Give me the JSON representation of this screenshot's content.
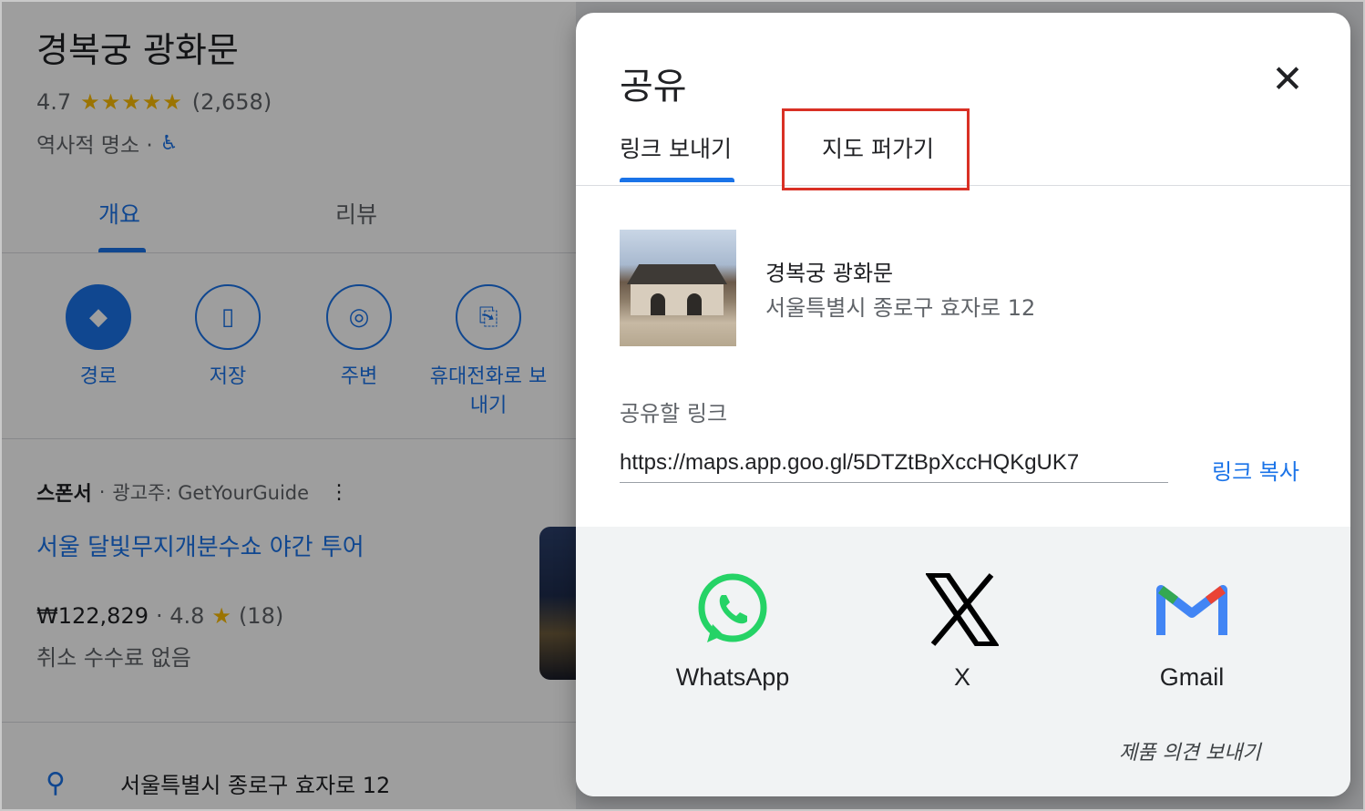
{
  "place": {
    "title": "경복궁 광화문",
    "rating": "4.7",
    "stars": "★★★★★",
    "review_count": "(2,658)",
    "category": "역사적 명소 ·",
    "tabs": [
      "개요",
      "리뷰"
    ],
    "actions": [
      {
        "label": "경로",
        "icon": "directions-icon"
      },
      {
        "label": "저장",
        "icon": "bookmark-icon"
      },
      {
        "label": "주변",
        "icon": "nearby-icon"
      },
      {
        "label": "휴대전화로 보\n내기",
        "icon": "send-to-phone-icon"
      }
    ],
    "sponsor": {
      "label": "스폰서",
      "advertiser": "광고주: GetYourGuide"
    },
    "ad_title": "서울 달빛무지개분수쇼 야간 투어",
    "ad_price": "₩122,829",
    "ad_rating": "· 4.8",
    "ad_star": "★",
    "ad_reviews": "(18)",
    "ad_note": "취소 수수료 없음",
    "address": "서울특별시 종로구 효자로 12"
  },
  "dialog": {
    "title": "공유",
    "close_glyph": "✕",
    "tabs": [
      "링크 보내기",
      "지도 퍼가기"
    ],
    "place_name": "경복궁 광화문",
    "place_address": "서울특별시 종로구 효자로 12",
    "link_label": "공유할 링크",
    "link_value": "https://maps.app.goo.gl/5DTZtBpXccHQKgUK7",
    "copy_label": "링크 복사",
    "share_targets": [
      {
        "label": "WhatsApp",
        "icon": "whatsapp-icon",
        "color": "#25d366"
      },
      {
        "label": "X",
        "icon": "x-icon",
        "color": "#000000"
      },
      {
        "label": "Gmail",
        "icon": "gmail-icon",
        "color": "#4285f4"
      }
    ],
    "feedback": "제품 의견 보내기"
  },
  "colors": {
    "accent": "#1a73e8",
    "highlight": "#d93025",
    "star": "#fbbc04"
  }
}
